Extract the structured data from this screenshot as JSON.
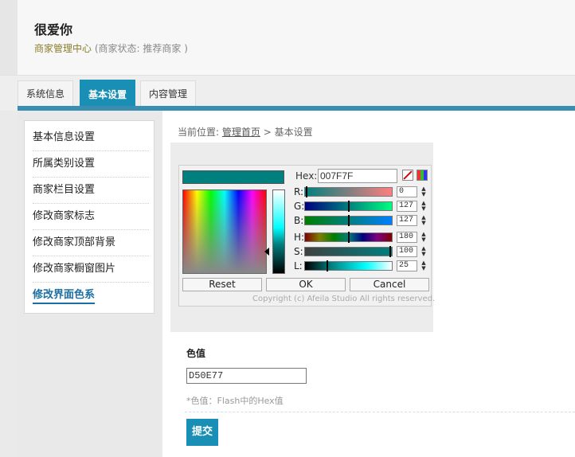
{
  "header": {
    "title": "很爱你",
    "center_link": "商家管理中心",
    "status_text": "(商家状态: 推荐商家 )"
  },
  "tabs": [
    {
      "label": "系统信息",
      "active": false
    },
    {
      "label": "基本设置",
      "active": true
    },
    {
      "label": "内容管理",
      "active": false
    }
  ],
  "sidebar": {
    "items": [
      {
        "label": "基本信息设置"
      },
      {
        "label": "所属类别设置"
      },
      {
        "label": "商家栏目设置"
      },
      {
        "label": "修改商家标志"
      },
      {
        "label": "修改商家顶部背景"
      },
      {
        "label": "修改商家橱窗图片"
      },
      {
        "label": "修改界面色系",
        "active": true
      }
    ]
  },
  "breadcrumb": {
    "prefix": "当前位置:",
    "home": "管理首页",
    "sep": ">",
    "current": "基本设置"
  },
  "picker": {
    "hex_label": "Hex:",
    "hex_value": "007F7F",
    "selected_color": "#007F7F",
    "channels": [
      {
        "label": "R:",
        "value": "0"
      },
      {
        "label": "G:",
        "value": "127"
      },
      {
        "label": "B:",
        "value": "127"
      },
      {
        "label": "H:",
        "value": "180"
      },
      {
        "label": "S:",
        "value": "100"
      },
      {
        "label": "L:",
        "value": "25"
      }
    ],
    "reset_label": "Reset",
    "ok_label": "OK",
    "cancel_label": "Cancel",
    "copyright": "Copyright (c) Afeila Studio All rights reserved."
  },
  "form": {
    "label": "色值",
    "value": "D50E77",
    "hint": "*色值：Flash中的Hex值",
    "submit_label": "提交"
  },
  "colors": {
    "accent": "#1a8fb5",
    "tab_rule": "#3a8fb0"
  }
}
